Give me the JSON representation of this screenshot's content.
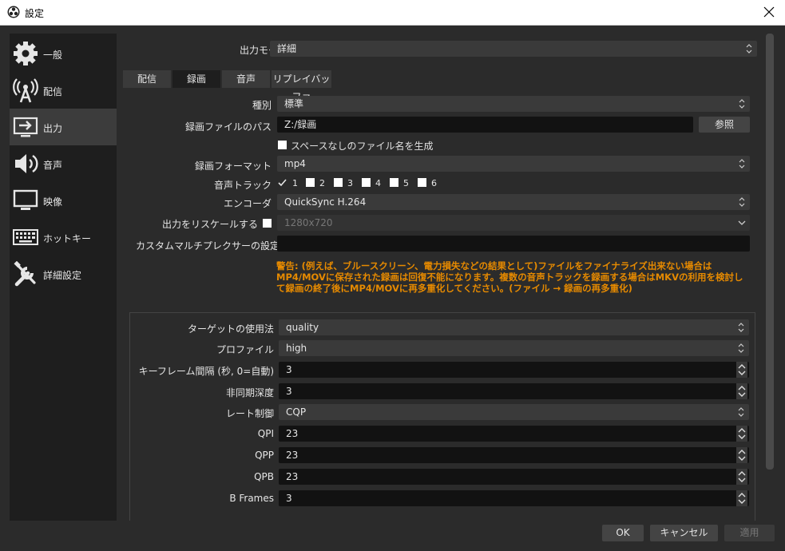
{
  "window": {
    "title": "設定"
  },
  "sidebar": {
    "items": [
      {
        "label": "一般",
        "icon": "gear-icon"
      },
      {
        "label": "配信",
        "icon": "broadcast-tower-icon"
      },
      {
        "label": "出力",
        "icon": "output-monitor-icon"
      },
      {
        "label": "音声",
        "icon": "speaker-icon"
      },
      {
        "label": "映像",
        "icon": "monitor-icon"
      },
      {
        "label": "ホットキー",
        "icon": "keyboard-icon"
      },
      {
        "label": "詳細設定",
        "icon": "tools-icon"
      }
    ],
    "active": "出力"
  },
  "output": {
    "mode_label": "出力モード",
    "mode_value": "詳細",
    "tabs": [
      "配信",
      "録画",
      "音声",
      "リプレイバッファ"
    ],
    "active_tab": "録画"
  },
  "recording": {
    "type_label": "種別",
    "type_value": "標準",
    "path_label": "録画ファイルのパス",
    "path_value": "Z:/録画",
    "browse_label": "参照",
    "nospace_label": "スペースなしのファイル名を生成",
    "nospace_checked": false,
    "format_label": "録画フォーマット",
    "format_value": "mp4",
    "tracks_label": "音声トラック",
    "tracks": [
      {
        "num": "1",
        "checked": true
      },
      {
        "num": "2",
        "checked": false
      },
      {
        "num": "3",
        "checked": false
      },
      {
        "num": "4",
        "checked": false
      },
      {
        "num": "5",
        "checked": false
      },
      {
        "num": "6",
        "checked": false
      }
    ],
    "encoder_label": "エンコーダ",
    "encoder_value": "QuickSync H.264",
    "rescale_label": "出力をリスケールする",
    "rescale_checked": false,
    "rescale_value": "1280x720",
    "muxer_label": "カスタムマルチプレクサーの設定",
    "muxer_value": "",
    "warning": "警告: (例えば、ブルースクリーン、電力損失などの結果として)ファイルをファイナライズ出来ない場合はMP4/MOVに保存された録画は回復不能になります。複数の音声トラックを録画する場合はMKVの利用を検討して録画の終了後にMP4/MOVに再多重化してください。(ファイル → 録画の再多重化)"
  },
  "encoder_settings": {
    "target_label": "ターゲットの使用法",
    "target_value": "quality",
    "profile_label": "プロファイル",
    "profile_value": "high",
    "keyframe_label": "キーフレーム間隔 (秒, 0=自動)",
    "keyframe_value": "3",
    "async_label": "非同期深度",
    "async_value": "3",
    "rate_label": "レート制御",
    "rate_value": "CQP",
    "qpi_label": "QPI",
    "qpi_value": "23",
    "qpp_label": "QPP",
    "qpp_value": "23",
    "qpb_label": "QPB",
    "qpb_value": "23",
    "bframes_label": "B Frames",
    "bframes_value": "3"
  },
  "footer": {
    "ok_label": "OK",
    "cancel_label": "キャンセル",
    "apply_label": "適用"
  },
  "colors": {
    "warning": "#e68a00",
    "background": "#2b2b2b",
    "sidebar": "#1e1e1e"
  }
}
